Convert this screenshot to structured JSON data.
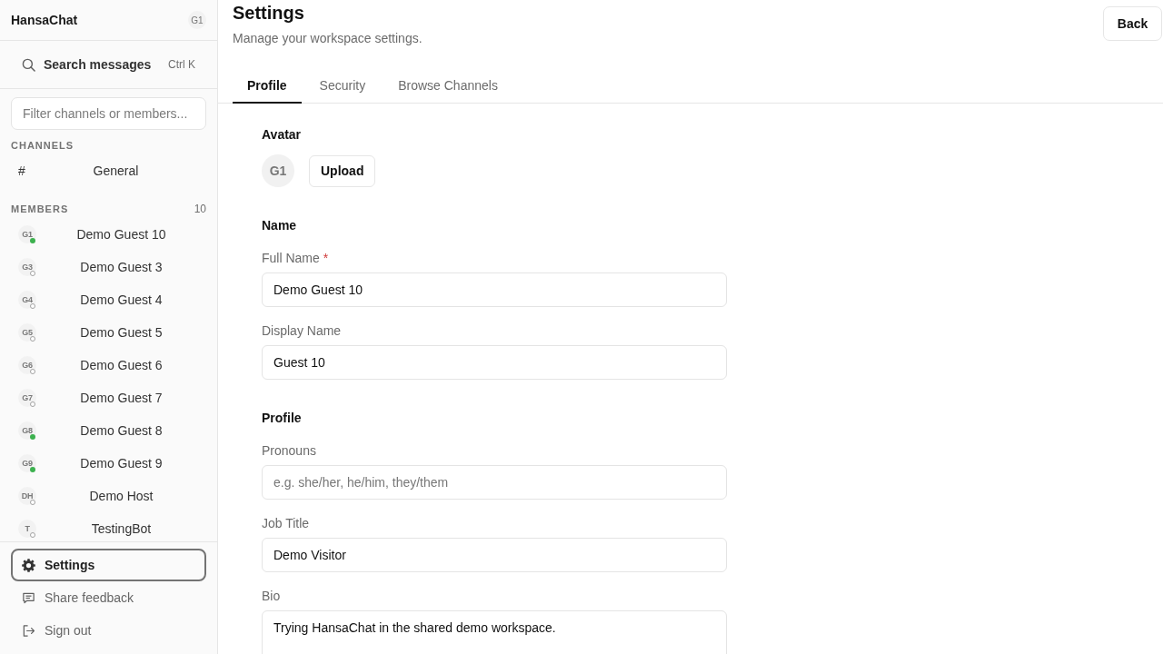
{
  "sidebar": {
    "app_name": "HansaChat",
    "user_initials": "G1",
    "search": {
      "label": "Search messages",
      "shortcut": "Ctrl K"
    },
    "filter": {
      "placeholder": "Filter channels or members..."
    },
    "channels": {
      "heading": "CHANNELS",
      "items": [
        {
          "symbol": "#",
          "name": "General"
        }
      ]
    },
    "members": {
      "heading": "MEMBERS",
      "count": "10",
      "items": [
        {
          "initials": "G1",
          "name": "Demo Guest 10",
          "online": true
        },
        {
          "initials": "G3",
          "name": "Demo Guest 3",
          "online": false
        },
        {
          "initials": "G4",
          "name": "Demo Guest 4",
          "online": false
        },
        {
          "initials": "G5",
          "name": "Demo Guest 5",
          "online": false
        },
        {
          "initials": "G6",
          "name": "Demo Guest 6",
          "online": false
        },
        {
          "initials": "G7",
          "name": "Demo Guest 7",
          "online": false
        },
        {
          "initials": "G8",
          "name": "Demo Guest 8",
          "online": true
        },
        {
          "initials": "G9",
          "name": "Demo Guest 9",
          "online": true
        },
        {
          "initials": "DH",
          "name": "Demo Host",
          "online": false
        },
        {
          "initials": "T",
          "name": "TestingBot",
          "online": false
        }
      ]
    },
    "footer": [
      {
        "kind": "settings",
        "label": "Settings",
        "selected": true
      },
      {
        "kind": "feedback",
        "label": "Share feedback",
        "selected": false
      },
      {
        "kind": "sign_out",
        "label": "Sign out",
        "selected": false
      }
    ]
  },
  "header": {
    "title": "Settings",
    "subtitle": "Manage your workspace settings.",
    "back_button": "Back"
  },
  "tabs": [
    {
      "label": "Profile",
      "selected": true
    },
    {
      "label": "Security",
      "selected": false
    },
    {
      "label": "Browse Channels",
      "selected": false
    }
  ],
  "profile_form": {
    "avatar": {
      "heading": "Avatar",
      "initials": "G1",
      "upload_button": "Upload"
    },
    "sections": [
      {
        "heading": "Name",
        "fields": [
          {
            "kind": "input",
            "label": "Full Name",
            "required_mark": "*",
            "value": "Demo Guest 10"
          },
          {
            "kind": "input",
            "label": "Display Name",
            "value": "Guest 10"
          }
        ]
      },
      {
        "heading": "Profile",
        "fields": [
          {
            "kind": "input",
            "label": "Pronouns",
            "placeholder": "e.g. she/her, he/him, they/them"
          },
          {
            "kind": "input",
            "label": "Job Title",
            "value": "Demo Visitor"
          },
          {
            "kind": "textarea",
            "label": "Bio",
            "value": "Trying HansaChat in the shared demo workspace."
          }
        ]
      }
    ]
  }
}
